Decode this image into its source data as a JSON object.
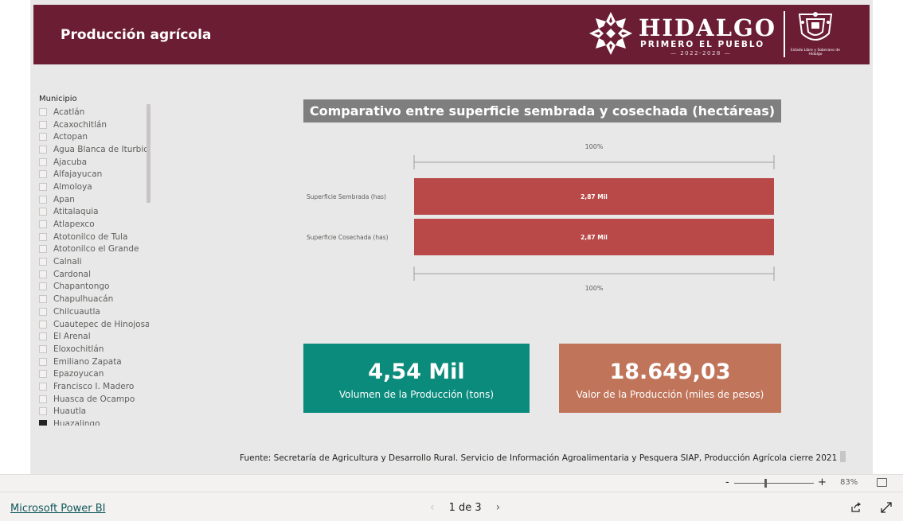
{
  "header": {
    "title": "Producción agrícola",
    "logo_name": "HIDALGO",
    "logo_tagline": "PRIMERO EL PUEBLO",
    "logo_years": "— 2022-2028 —",
    "seal_caption": "Estado Libre y Soberano de Hidalgo",
    "bg_color": "#6b1d33"
  },
  "slicer": {
    "title": "Municipio",
    "items": [
      {
        "label": "Acatlán",
        "checked": false
      },
      {
        "label": "Acaxochitlán",
        "checked": false
      },
      {
        "label": "Actopan",
        "checked": false
      },
      {
        "label": "Agua Blanca de Iturbide",
        "checked": false
      },
      {
        "label": "Ajacuba",
        "checked": false
      },
      {
        "label": "Alfajayucan",
        "checked": false
      },
      {
        "label": "Almoloya",
        "checked": false
      },
      {
        "label": "Apan",
        "checked": false
      },
      {
        "label": "Atitalaquia",
        "checked": false
      },
      {
        "label": "Atlapexco",
        "checked": false
      },
      {
        "label": "Atotonilco de Tula",
        "checked": false
      },
      {
        "label": "Atotonilco el Grande",
        "checked": false
      },
      {
        "label": "Calnali",
        "checked": false
      },
      {
        "label": "Cardonal",
        "checked": false
      },
      {
        "label": "Chapantongo",
        "checked": false
      },
      {
        "label": "Chapulhuacán",
        "checked": false
      },
      {
        "label": "Chilcuautla",
        "checked": false
      },
      {
        "label": "Cuautepec de Hinojosa",
        "checked": false
      },
      {
        "label": "El Arenal",
        "checked": false
      },
      {
        "label": "Eloxochitlán",
        "checked": false
      },
      {
        "label": "Emiliano Zapata",
        "checked": false
      },
      {
        "label": "Epazoyucan",
        "checked": false
      },
      {
        "label": "Francisco I. Madero",
        "checked": false
      },
      {
        "label": "Huasca de Ocampo",
        "checked": false
      },
      {
        "label": "Huautla",
        "checked": false
      },
      {
        "label": "Huazalingo",
        "checked": true
      }
    ]
  },
  "chart_title": "Comparativo entre superficie sembrada y cosechada (hectáreas)",
  "chart_data": {
    "type": "bar",
    "orientation": "horizontal",
    "categories": [
      "Superficie Sembrada (has)",
      "Superficie Cosechada (has)"
    ],
    "values": [
      2870,
      2870
    ],
    "data_labels": [
      "2,87 Mil",
      "2,87 Mil"
    ],
    "percent_labels": [
      "100%",
      "100%"
    ],
    "bar_color": "#b94848",
    "xlim": [
      0,
      2870
    ]
  },
  "cards": [
    {
      "value": "4,54 Mil",
      "label": "Volumen de la Producción (tons)",
      "color": "#0a8b7c"
    },
    {
      "value": "18.649,03",
      "label": "Valor de la Producción (miles de pesos)",
      "color": "#c0745a"
    }
  ],
  "source_note": "Fuente: Secretaría de Agricultura y Desarrollo Rural. Servicio de Información Agroalimentaria y Pesquera SIAP, Producción Agrícola cierre 2021",
  "zoom": {
    "minus": "-",
    "plus": "+",
    "level": "83%"
  },
  "footer": {
    "brand": "Microsoft Power BI",
    "page_indicator": "1 de 3",
    "prev_icon": "chevron-left-icon",
    "next_icon": "chevron-right-icon",
    "share_icon": "share-icon",
    "expand_icon": "expand-icon"
  }
}
